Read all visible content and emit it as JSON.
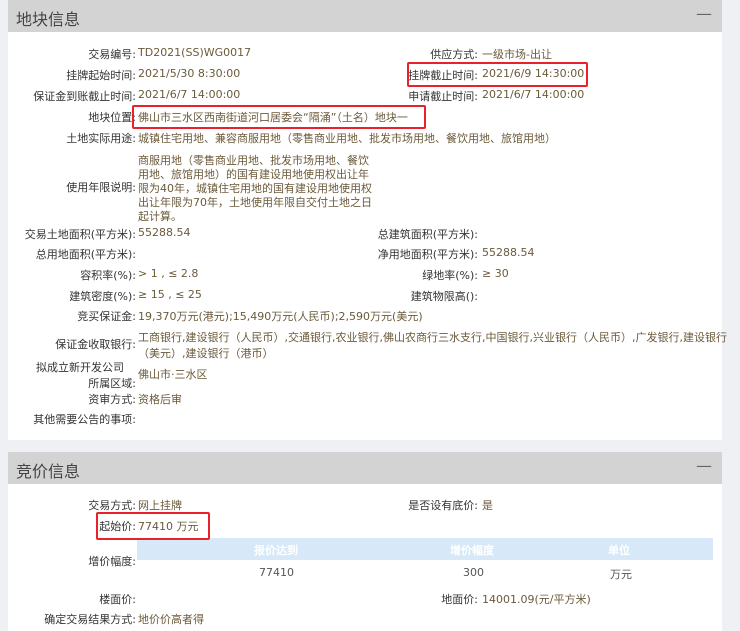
{
  "section1": {
    "title": "地块信息",
    "collapse": "—",
    "rows": [
      {
        "label": "交易编号:",
        "value": "TD2021(SS)WG0017"
      },
      {
        "label": "挂牌起始时间:",
        "value": "2021/5/30 8:30:00"
      },
      {
        "label": "保证金到账截止时间:",
        "value": "2021/6/7 14:00:00"
      },
      {
        "label": "地块位置:",
        "value": "佛山市三水区西南街道河口居委会“隔涌”（土名）地块一"
      },
      {
        "label": "土地实际用途:",
        "value": "城镇住宅用地、兼容商服用地（零售商业用地、批发市场用地、餐饮用地、旅馆用地）"
      },
      {
        "label": "使用年限说明:",
        "lines": [
          "商服用地（零售商业用地、批发市场用地、餐饮",
          "用地、旅馆用地）的国有建设用地使用权出让年",
          "限为40年，城镇住宅用地的国有建设用地使用权",
          "出让年限为70年，土地使用年限自交付土地之日",
          "起计算。"
        ]
      },
      {
        "label": "交易土地面积(平方米):",
        "value": "55288.54"
      },
      {
        "label": "总用地面积(平方米):",
        "value": ""
      },
      {
        "label": "容积率(%):",
        "value": "> 1 , ≤ 2.8"
      },
      {
        "label": "建筑密度(%):",
        "value": "≥ 15 , ≤ 25"
      },
      {
        "label": "竞买保证金:",
        "value": "19,370万元(港元);15,490万元(人民币);2,590万元(美元)"
      },
      {
        "label": "保证金收取银行:",
        "lines": [
          "工商银行,建设银行（人民币）,交通银行,农业银行,佛山农商行三水支行,中国银行,兴业银行（人民币）,广发银行,建设银行",
          "（美元）,建设银行（港币）"
        ]
      },
      {
        "label1": "拟成立新开发公司",
        "label2": "所属区域:",
        "value": "佛山市·三水区"
      },
      {
        "label": "资审方式:",
        "value": "资格后审"
      },
      {
        "label": "其他需要公告的事项:",
        "value": ""
      }
    ],
    "right": [
      {
        "label": "供应方式:",
        "value": "一级市场-出让"
      },
      {
        "label": "挂牌截止时间:",
        "value": "2021/6/9 14:30:00"
      },
      {
        "label": "申请截止时间:",
        "value": "2021/6/7 14:00:00"
      },
      {
        "label": "总建筑面积(平方米):",
        "value": ""
      },
      {
        "label": "净用地面积(平方米):",
        "value": "55288.54"
      },
      {
        "label": "绿地率(%):",
        "value": "≥ 30"
      },
      {
        "label": "建筑物限高():",
        "value": ""
      }
    ]
  },
  "section2": {
    "title": "竞价信息",
    "collapse": "—",
    "trade_method": {
      "label": "交易方式:",
      "value": "网上挂牌"
    },
    "reserve": {
      "label": "是否设有底价:",
      "value": "是"
    },
    "start_price": {
      "label": "起始价:",
      "value": "77410 万元"
    },
    "increment": {
      "label": "增价幅度:",
      "headers": [
        "报价达到",
        "增价幅度",
        "单位"
      ],
      "row": [
        "77410",
        "300",
        "万元"
      ]
    },
    "floor_price": {
      "label": "楼面价:",
      "value": ""
    },
    "land_price": {
      "label": "地面价:",
      "value": "14001.09(元/平方米)"
    },
    "result_method": {
      "label": "确定交易结果方式:",
      "value": "地价价高者得"
    }
  }
}
